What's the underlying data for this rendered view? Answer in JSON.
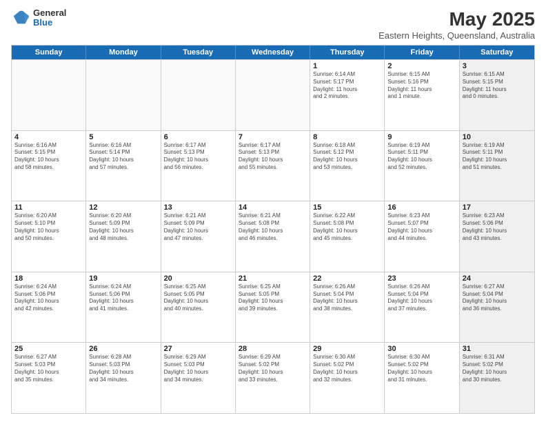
{
  "logo": {
    "general": "General",
    "blue": "Blue"
  },
  "title": {
    "month": "May 2025",
    "location": "Eastern Heights, Queensland, Australia"
  },
  "weekdays": [
    "Sunday",
    "Monday",
    "Tuesday",
    "Wednesday",
    "Thursday",
    "Friday",
    "Saturday"
  ],
  "rows": [
    [
      {
        "day": "",
        "info": "",
        "empty": true
      },
      {
        "day": "",
        "info": "",
        "empty": true
      },
      {
        "day": "",
        "info": "",
        "empty": true
      },
      {
        "day": "",
        "info": "",
        "empty": true
      },
      {
        "day": "1",
        "info": "Sunrise: 6:14 AM\nSunset: 5:17 PM\nDaylight: 11 hours\nand 2 minutes."
      },
      {
        "day": "2",
        "info": "Sunrise: 6:15 AM\nSunset: 5:16 PM\nDaylight: 11 hours\nand 1 minute."
      },
      {
        "day": "3",
        "info": "Sunrise: 6:15 AM\nSunset: 5:15 PM\nDaylight: 11 hours\nand 0 minutes.",
        "shaded": true
      }
    ],
    [
      {
        "day": "4",
        "info": "Sunrise: 6:16 AM\nSunset: 5:15 PM\nDaylight: 10 hours\nand 58 minutes."
      },
      {
        "day": "5",
        "info": "Sunrise: 6:16 AM\nSunset: 5:14 PM\nDaylight: 10 hours\nand 57 minutes."
      },
      {
        "day": "6",
        "info": "Sunrise: 6:17 AM\nSunset: 5:13 PM\nDaylight: 10 hours\nand 56 minutes."
      },
      {
        "day": "7",
        "info": "Sunrise: 6:17 AM\nSunset: 5:13 PM\nDaylight: 10 hours\nand 55 minutes."
      },
      {
        "day": "8",
        "info": "Sunrise: 6:18 AM\nSunset: 5:12 PM\nDaylight: 10 hours\nand 53 minutes."
      },
      {
        "day": "9",
        "info": "Sunrise: 6:19 AM\nSunset: 5:11 PM\nDaylight: 10 hours\nand 52 minutes."
      },
      {
        "day": "10",
        "info": "Sunrise: 6:19 AM\nSunset: 5:11 PM\nDaylight: 10 hours\nand 51 minutes.",
        "shaded": true
      }
    ],
    [
      {
        "day": "11",
        "info": "Sunrise: 6:20 AM\nSunset: 5:10 PM\nDaylight: 10 hours\nand 50 minutes."
      },
      {
        "day": "12",
        "info": "Sunrise: 6:20 AM\nSunset: 5:09 PM\nDaylight: 10 hours\nand 48 minutes."
      },
      {
        "day": "13",
        "info": "Sunrise: 6:21 AM\nSunset: 5:09 PM\nDaylight: 10 hours\nand 47 minutes."
      },
      {
        "day": "14",
        "info": "Sunrise: 6:21 AM\nSunset: 5:08 PM\nDaylight: 10 hours\nand 46 minutes."
      },
      {
        "day": "15",
        "info": "Sunrise: 6:22 AM\nSunset: 5:08 PM\nDaylight: 10 hours\nand 45 minutes."
      },
      {
        "day": "16",
        "info": "Sunrise: 6:23 AM\nSunset: 5:07 PM\nDaylight: 10 hours\nand 44 minutes."
      },
      {
        "day": "17",
        "info": "Sunrise: 6:23 AM\nSunset: 5:06 PM\nDaylight: 10 hours\nand 43 minutes.",
        "shaded": true
      }
    ],
    [
      {
        "day": "18",
        "info": "Sunrise: 6:24 AM\nSunset: 5:06 PM\nDaylight: 10 hours\nand 42 minutes."
      },
      {
        "day": "19",
        "info": "Sunrise: 6:24 AM\nSunset: 5:06 PM\nDaylight: 10 hours\nand 41 minutes."
      },
      {
        "day": "20",
        "info": "Sunrise: 6:25 AM\nSunset: 5:05 PM\nDaylight: 10 hours\nand 40 minutes."
      },
      {
        "day": "21",
        "info": "Sunrise: 6:25 AM\nSunset: 5:05 PM\nDaylight: 10 hours\nand 39 minutes."
      },
      {
        "day": "22",
        "info": "Sunrise: 6:26 AM\nSunset: 5:04 PM\nDaylight: 10 hours\nand 38 minutes."
      },
      {
        "day": "23",
        "info": "Sunrise: 6:26 AM\nSunset: 5:04 PM\nDaylight: 10 hours\nand 37 minutes."
      },
      {
        "day": "24",
        "info": "Sunrise: 6:27 AM\nSunset: 5:04 PM\nDaylight: 10 hours\nand 36 minutes.",
        "shaded": true
      }
    ],
    [
      {
        "day": "25",
        "info": "Sunrise: 6:27 AM\nSunset: 5:03 PM\nDaylight: 10 hours\nand 35 minutes."
      },
      {
        "day": "26",
        "info": "Sunrise: 6:28 AM\nSunset: 5:03 PM\nDaylight: 10 hours\nand 34 minutes."
      },
      {
        "day": "27",
        "info": "Sunrise: 6:29 AM\nSunset: 5:03 PM\nDaylight: 10 hours\nand 34 minutes."
      },
      {
        "day": "28",
        "info": "Sunrise: 6:29 AM\nSunset: 5:02 PM\nDaylight: 10 hours\nand 33 minutes."
      },
      {
        "day": "29",
        "info": "Sunrise: 6:30 AM\nSunset: 5:02 PM\nDaylight: 10 hours\nand 32 minutes."
      },
      {
        "day": "30",
        "info": "Sunrise: 6:30 AM\nSunset: 5:02 PM\nDaylight: 10 hours\nand 31 minutes."
      },
      {
        "day": "31",
        "info": "Sunrise: 6:31 AM\nSunset: 5:02 PM\nDaylight: 10 hours\nand 30 minutes.",
        "shaded": true
      }
    ]
  ]
}
